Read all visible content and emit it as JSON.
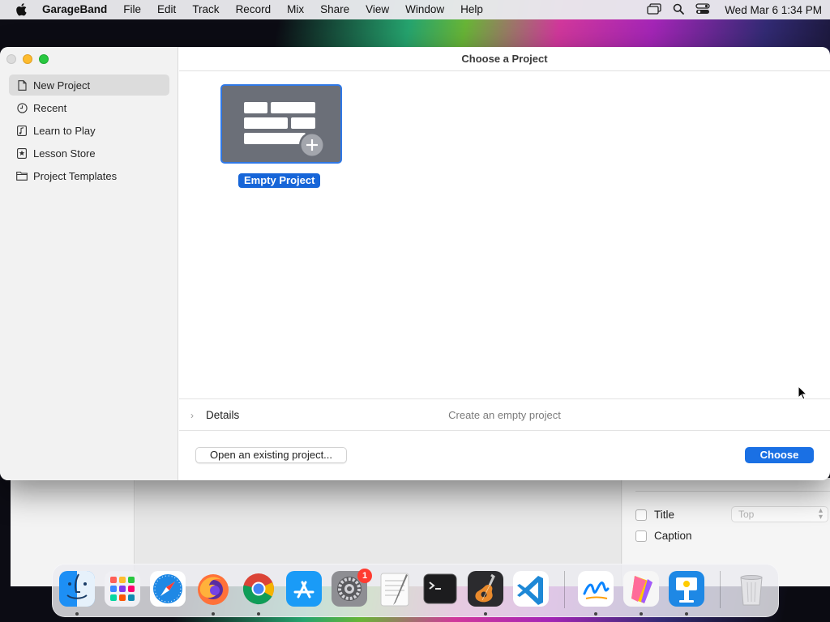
{
  "menubar": {
    "app_name": "GarageBand",
    "items": [
      "File",
      "Edit",
      "Track",
      "Record",
      "Mix",
      "Share",
      "View",
      "Window",
      "Help"
    ],
    "clock": "Wed Mar 6  1:34 PM"
  },
  "dialog": {
    "title": "Choose a Project",
    "sidebar": [
      {
        "label": "New Project",
        "icon": "document-icon",
        "selected": true
      },
      {
        "label": "Recent",
        "icon": "clock-icon",
        "selected": false
      },
      {
        "label": "Learn to Play",
        "icon": "music-note-icon",
        "selected": false
      },
      {
        "label": "Lesson Store",
        "icon": "star-icon",
        "selected": false
      },
      {
        "label": "Project Templates",
        "icon": "folder-icon",
        "selected": false
      }
    ],
    "project_tile_label": "Empty Project",
    "details_label": "Details",
    "details_description": "Create an empty project",
    "open_button": "Open an existing project...",
    "choose_button": "Choose"
  },
  "background_window": {
    "title_checkbox": "Title",
    "caption_checkbox": "Caption",
    "position_select": "Top"
  },
  "dock": {
    "apps": [
      "Finder",
      "Launchpad",
      "Safari",
      "Firefox",
      "Chrome",
      "App Store",
      "System Settings",
      "TextEdit",
      "Terminal",
      "GarageBand",
      "Visual Studio Code",
      "Freeform",
      "Pages",
      "Keynote",
      "Trash"
    ],
    "settings_badge": "1"
  },
  "colors": {
    "accent": "#1a70e4",
    "tile_border": "#2f78e6",
    "badge": "#ff3b30"
  }
}
